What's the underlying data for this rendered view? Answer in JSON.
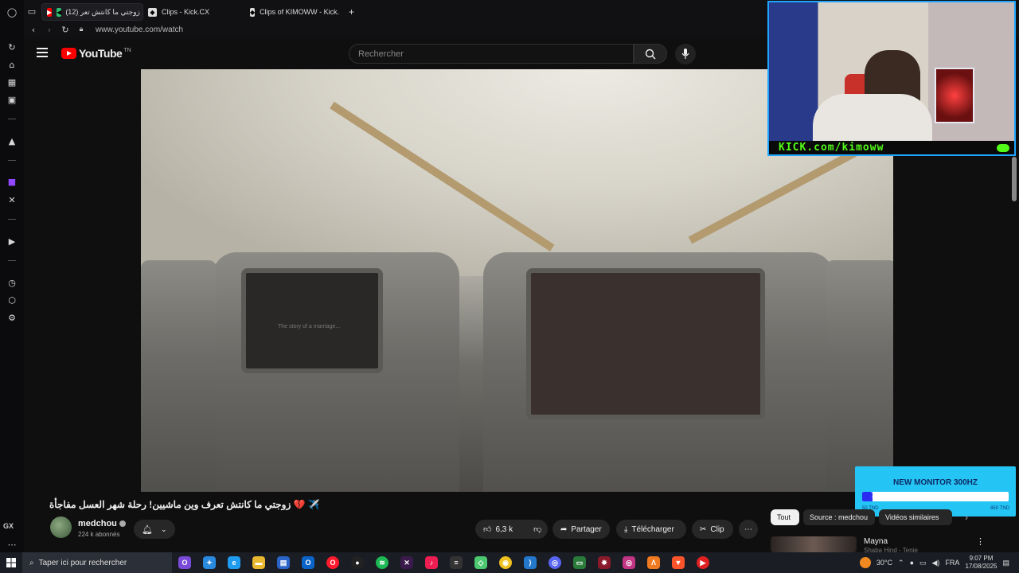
{
  "browser": {
    "tabs": [
      {
        "label": "(12) زوجتي ما كانتش تعر",
        "active": true
      },
      {
        "label": "Clips - Kick.CX",
        "active": false
      },
      {
        "label": "Clips of KIMOWW - Kick.",
        "active": false
      }
    ],
    "new_tab_symbol": "+",
    "url": "www.youtube.com/watch",
    "sidebar_label": "GX"
  },
  "youtube": {
    "logo_text": "YouTube",
    "region": "TN",
    "search_placeholder": "Rechercher"
  },
  "video": {
    "screen_caption": "The story of a marriage..."
  },
  "stream_overlay": {
    "banner_text": "KICK.com/kimoww"
  },
  "ad": {
    "title": "NEW MONITOR 300HZ",
    "min_label": "50 TND",
    "max_label": "850 TND",
    "progress_fraction": 0.07,
    "progress_label": "7"
  },
  "watch": {
    "title": "✈️ 💔 زوجتي ما كانتش تعرف وين ماشيين! رحلة شهر العسل مفاجأة",
    "channel_name": "medchou",
    "subscribers": "224 k abonnés",
    "likes": "6,3 k",
    "share_label": "Partager",
    "download_label": "Télécharger",
    "clip_label": "Clip"
  },
  "sidebar_chips": [
    {
      "label": "Tout",
      "active": true
    },
    {
      "label": "Source : medchou",
      "active": false
    },
    {
      "label": "Vidéos similaires",
      "active": false
    }
  ],
  "recommendation": {
    "title": "Mayna",
    "subtitle": "Shaba Hind - Tenie"
  },
  "taskbar": {
    "search_placeholder": "Taper ici pour rechercher",
    "weather": "30°C",
    "language": "FRA",
    "time": "9:07 PM",
    "date": "17/08/2025"
  },
  "colors": {
    "youtube_red": "#ff0000",
    "kick_green": "#53fc18",
    "stream_border": "#1ea6ff",
    "ad_background": "#24c4f4"
  }
}
